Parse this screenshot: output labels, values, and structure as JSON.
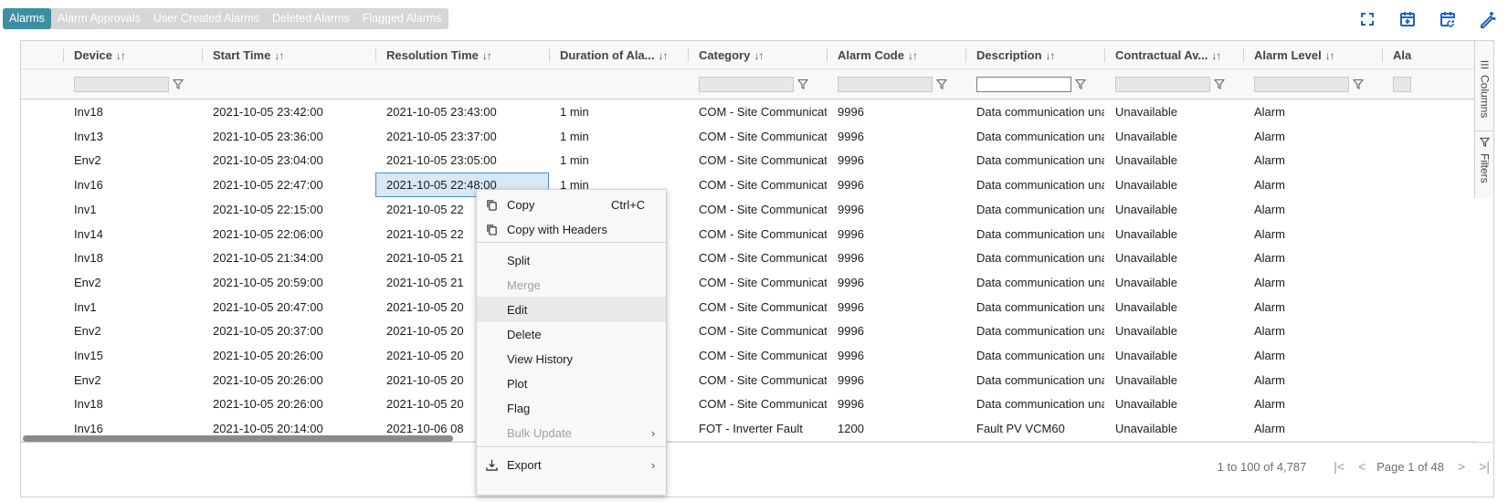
{
  "tabs": [
    "Alarms",
    "Alarm Approvals",
    "User Created Alarms",
    "Deleted Alarms",
    "Flagged Alarms"
  ],
  "toolbar_icons": [
    "fullscreen-icon",
    "calendar-add-icon",
    "calendar-refresh-icon",
    "edit-magic-icon"
  ],
  "columns": [
    {
      "label": "Device",
      "sort": "↓↑"
    },
    {
      "label": "Start Time",
      "sort": "↓↑"
    },
    {
      "label": "Resolution Time",
      "sort": "↓↑"
    },
    {
      "label": "Duration of Ala...",
      "sort": "↓↑"
    },
    {
      "label": "Category",
      "sort": "↓↑"
    },
    {
      "label": "Alarm Code",
      "sort": "↓↑"
    },
    {
      "label": "Description",
      "sort": "↓↑"
    },
    {
      "label": "Contractual Av...",
      "sort": "↓↑"
    },
    {
      "label": "Alarm Level",
      "sort": "↓↑"
    },
    {
      "label": "Ala",
      "sort": ""
    }
  ],
  "rows": [
    [
      "Inv18",
      "2021-10-05 23:42:00",
      "2021-10-05 23:43:00",
      "1 min",
      "COM - Site Communicatio",
      "9996",
      "Data communication unav",
      "Unavailable",
      "Alarm"
    ],
    [
      "Inv13",
      "2021-10-05 23:36:00",
      "2021-10-05 23:37:00",
      "1 min",
      "COM - Site Communicatio",
      "9996",
      "Data communication unav",
      "Unavailable",
      "Alarm"
    ],
    [
      "Env2",
      "2021-10-05 23:04:00",
      "2021-10-05 23:05:00",
      "1 min",
      "COM - Site Communicatio",
      "9996",
      "Data communication unav",
      "Unavailable",
      "Alarm"
    ],
    [
      "Inv16",
      "2021-10-05 22:47:00",
      "2021-10-05 22:48:00",
      "1 min",
      "COM - Site Communicatio",
      "9996",
      "Data communication unav",
      "Unavailable",
      "Alarm"
    ],
    [
      "Inv1",
      "2021-10-05 22:15:00",
      "2021-10-05 22",
      "",
      "COM - Site Communicatio",
      "9996",
      "Data communication unav",
      "Unavailable",
      "Alarm"
    ],
    [
      "Inv14",
      "2021-10-05 22:06:00",
      "2021-10-05 22",
      "",
      "COM - Site Communicatio",
      "9996",
      "Data communication unav",
      "Unavailable",
      "Alarm"
    ],
    [
      "Inv18",
      "2021-10-05 21:34:00",
      "2021-10-05 21",
      "",
      "COM - Site Communicatio",
      "9996",
      "Data communication unav",
      "Unavailable",
      "Alarm"
    ],
    [
      "Env2",
      "2021-10-05 20:59:00",
      "2021-10-05 21",
      "",
      "COM - Site Communicatio",
      "9996",
      "Data communication unav",
      "Unavailable",
      "Alarm"
    ],
    [
      "Inv1",
      "2021-10-05 20:47:00",
      "2021-10-05 20",
      "",
      "COM - Site Communicatio",
      "9996",
      "Data communication unav",
      "Unavailable",
      "Alarm"
    ],
    [
      "Env2",
      "2021-10-05 20:37:00",
      "2021-10-05 20",
      "",
      "COM - Site Communicatio",
      "9996",
      "Data communication unav",
      "Unavailable",
      "Alarm"
    ],
    [
      "Inv15",
      "2021-10-05 20:26:00",
      "2021-10-05 20",
      "",
      "COM - Site Communicatio",
      "9996",
      "Data communication unav",
      "Unavailable",
      "Alarm"
    ],
    [
      "Env2",
      "2021-10-05 20:26:00",
      "2021-10-05 20",
      "",
      "COM - Site Communicatio",
      "9996",
      "Data communication unav",
      "Unavailable",
      "Alarm"
    ],
    [
      "Inv18",
      "2021-10-05 20:26:00",
      "2021-10-05 20",
      "",
      "COM - Site Communicatio",
      "9996",
      "Data communication unav",
      "Unavailable",
      "Alarm"
    ],
    [
      "Inv16",
      "2021-10-05 20:14:00",
      "2021-10-06 08",
      "",
      "FOT - Inverter Fault",
      "1200",
      "Fault PV VCM60",
      "Unavailable",
      "Alarm"
    ]
  ],
  "context_menu": {
    "items": [
      {
        "label": "Copy",
        "shortcut": "Ctrl+C",
        "icon": "copy-icon",
        "disabled": false
      },
      {
        "label": "Copy with Headers",
        "shortcut": "",
        "icon": "copy-icon",
        "disabled": false
      },
      {
        "label": "Split",
        "shortcut": "",
        "icon": "",
        "disabled": false
      },
      {
        "label": "Merge",
        "shortcut": "",
        "icon": "",
        "disabled": true
      },
      {
        "label": "Edit",
        "shortcut": "",
        "icon": "",
        "disabled": false,
        "hover": true
      },
      {
        "label": "Delete",
        "shortcut": "",
        "icon": "",
        "disabled": false
      },
      {
        "label": "View History",
        "shortcut": "",
        "icon": "",
        "disabled": false
      },
      {
        "label": "Plot",
        "shortcut": "",
        "icon": "",
        "disabled": false
      },
      {
        "label": "Flag",
        "shortcut": "",
        "icon": "",
        "disabled": false
      },
      {
        "label": "Bulk Update",
        "shortcut": "",
        "icon": "",
        "disabled": true,
        "submenu": true
      },
      {
        "label": "Export",
        "shortcut": "",
        "icon": "download-icon",
        "disabled": false,
        "submenu": true
      }
    ]
  },
  "side_panel": {
    "columns_label": "Columns",
    "filters_label": "Filters"
  },
  "pagination": {
    "summary": "1 to 100 of 4,787",
    "page_text": "Page 1 of 48"
  },
  "colors": {
    "accent": "#3d8ea3",
    "icon_blue": "#1a63c7"
  }
}
